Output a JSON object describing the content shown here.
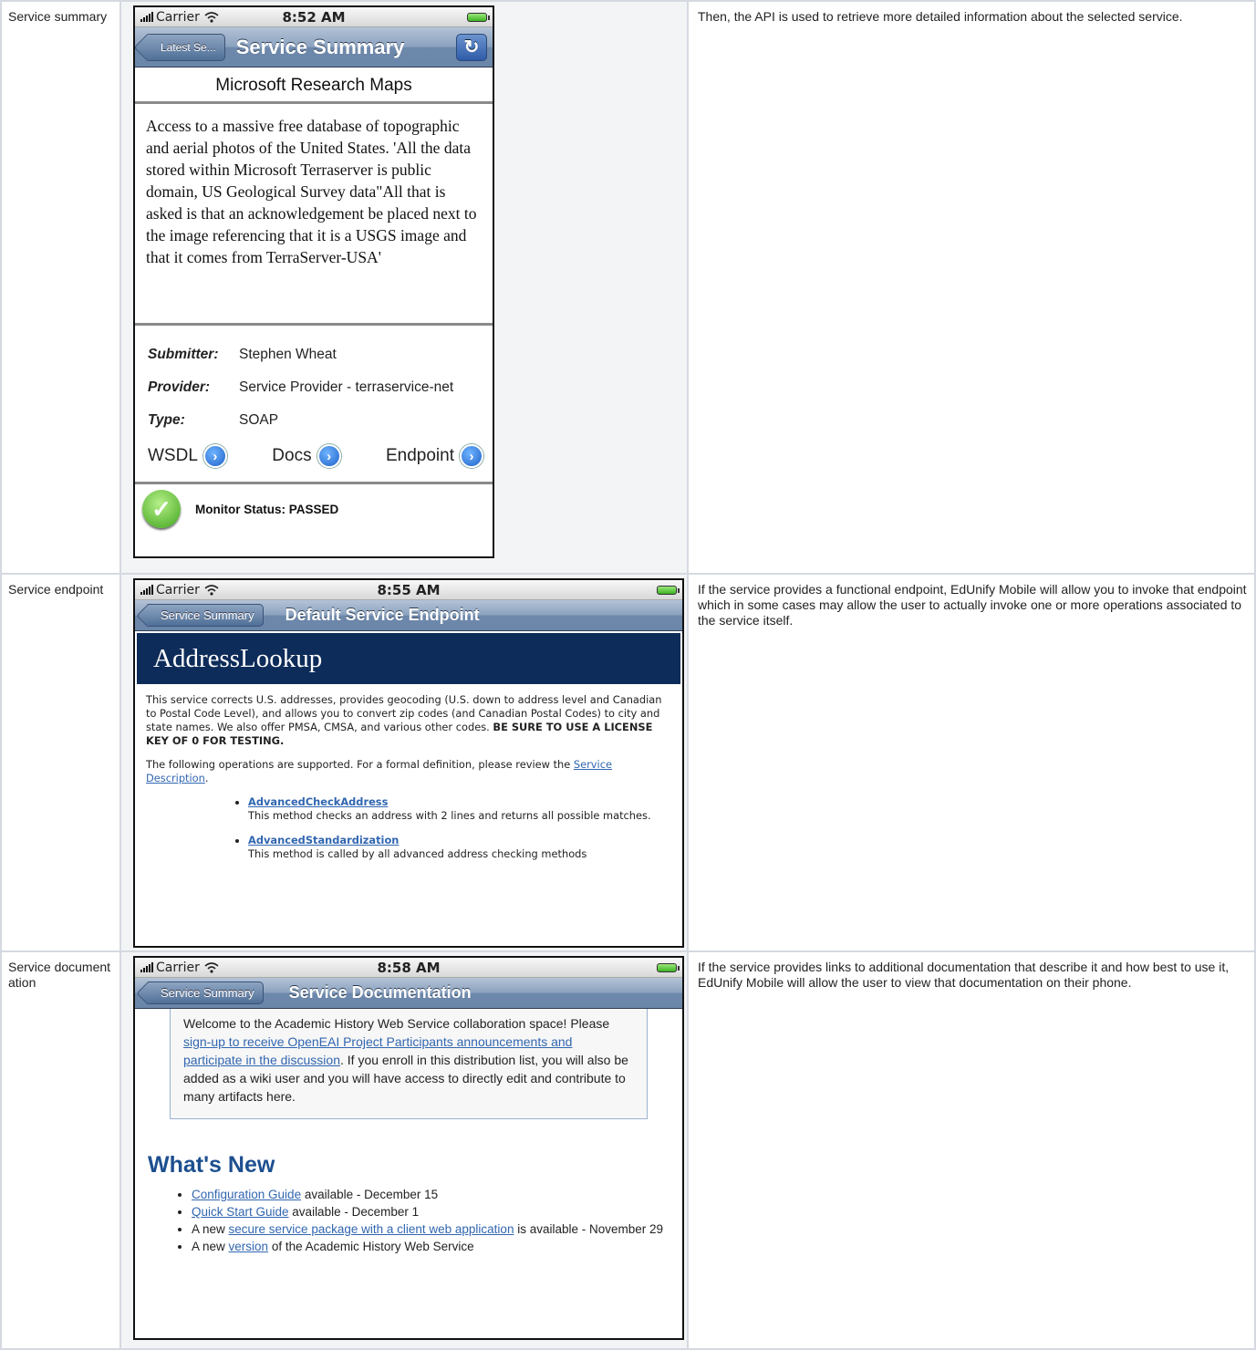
{
  "rows": [
    {
      "label": "Service summary",
      "description": "Then, the API is used to retrieve more detailed information about the selected service.",
      "phone": {
        "carrier": "Carrier",
        "time": "8:52 AM",
        "back_label": "Latest Se...",
        "nav_title": "Service Summary",
        "service_name": "Microsoft Research Maps",
        "service_description": "Access to a massive free database of topographic and aerial photos of the United States. 'All the data stored within Microsoft Terraserver is public domain, US Geological Survey data\"All that is asked is that an acknowledgement be placed next to the image referencing that it is a USGS image and that it comes from TerraServer-USA'",
        "submitter_label": "Submitter:",
        "submitter_value": "Stephen Wheat",
        "provider_label": "Provider:",
        "provider_value": "Service Provider - terraservice-net",
        "type_label": "Type:",
        "type_value": "SOAP",
        "link_wsdl": "WSDL",
        "link_docs": "Docs",
        "link_endpoint": "Endpoint",
        "monitor_status": "Monitor Status: PASSED"
      }
    },
    {
      "label": "Service endpoint",
      "description": "If the service provides a functional endpoint, EdUnify Mobile will allow you to invoke that endpoint which in some cases may allow the user to actually invoke one or more operations associated to the service itself.",
      "phone": {
        "carrier": "Carrier",
        "time": "8:55 AM",
        "back_label": "Service Summary",
        "nav_title": "Default Service Endpoint",
        "page_heading": "AddressLookup",
        "intro": "This service corrects U.S. addresses, provides geocoding (U.S. down to address level and Canadian to Postal Code Level), and allows you to convert zip codes (and Canadian Postal Codes) to city and state names. We also offer PMSA, CMSA, and various other codes.",
        "intro_bold": "BE SURE TO USE A LICENSE KEY OF 0 FOR TESTING.",
        "ops_intro": "The following operations are supported. For a formal definition, please review the",
        "ops_link": "Service Description",
        "ops_intro_end": ".",
        "operations": [
          {
            "name": "AdvancedCheckAddress",
            "desc": "This method checks an address with 2 lines and returns all possible matches."
          },
          {
            "name": "AdvancedStandardization",
            "desc": "This method is called by all advanced address checking methods"
          }
        ]
      }
    },
    {
      "label": "Service documentation",
      "description": "If the service provides links to additional documentation that describe it and how best to use it, EdUnify Mobile will allow the user to view that documentation on their phone.",
      "phone": {
        "carrier": "Carrier",
        "time": "8:58 AM",
        "back_label": "Service Summary",
        "nav_title": "Service Documentation",
        "welcome_1": "Welcome to the Academic History Web Service collaboration space!  Please",
        "welcome_link": "sign-up to receive OpenEAI Project Participants announcements and participate in the discussion",
        "welcome_2": ".  If you enroll in this distribution list, you will also be added as a wiki user and you will have access to directly edit and contribute to many artifacts here.",
        "whats_new": "What's New",
        "news": [
          {
            "link": "Configuration Guide",
            "text": " available - December 15"
          },
          {
            "link": "Quick Start Guide",
            "text": " available - December 1"
          },
          {
            "prefix": "A new ",
            "link": "secure service package with a client web application",
            "text": " is available - November 29"
          },
          {
            "prefix": "A new ",
            "link": "version",
            "text": " of the Academic History Web Service"
          }
        ]
      }
    }
  ]
}
